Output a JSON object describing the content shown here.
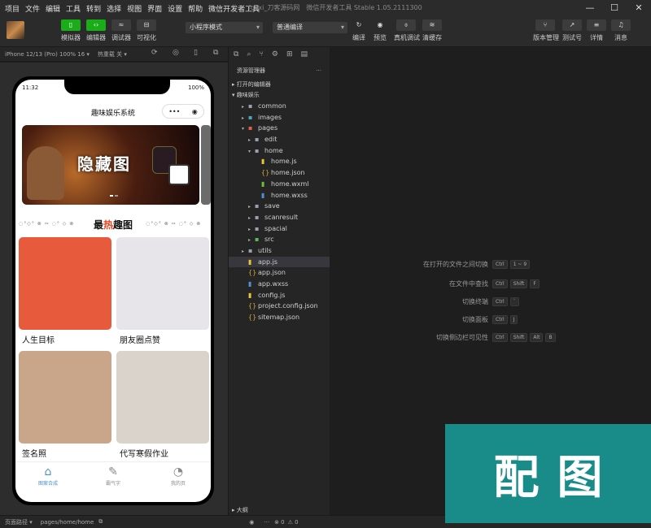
{
  "menubar": {
    "items": [
      "项目",
      "文件",
      "编辑",
      "工具",
      "转到",
      "选择",
      "视图",
      "界面",
      "设置",
      "帮助",
      "微信开发者工具"
    ],
    "window_title": "fooxi_刀客源码网　微信开发者工具 Stable 1.05.2111300",
    "controls": [
      "—",
      "☐",
      "✕"
    ]
  },
  "toolbar": {
    "simulator": "模拟器",
    "editor": "编辑器",
    "debugger": "调试器",
    "visual": "可视化",
    "mode_select": "小程序模式",
    "compile_select": "普通编译",
    "compile": "编译",
    "preview": "预览",
    "real_debug": "真机调试",
    "clear_cache": "清缓存",
    "version": "版本管理",
    "test": "测试号",
    "details": "详情",
    "messages": "消息"
  },
  "devbar": {
    "device": "iPhone 12/13 (Pro) 100% 16 ▾",
    "hot_reload": "热重载 关 ▾"
  },
  "phone": {
    "time": "11:32",
    "battery": "100%",
    "nav_title": "趣味娱乐系统",
    "capsule_menu": "•••",
    "capsule_close": "◉",
    "banner_text": "隐藏图",
    "section_title_a": "最",
    "section_title_hot": "热",
    "section_title_b": "趣图",
    "section_deco": "◌°◇° ⊗ ∾ ◌° ◇ ⊗",
    "cards": [
      {
        "label": "人生目标",
        "color": "#e85a3c"
      },
      {
        "label": "朋友圈点赞",
        "color": "#e7e4ea"
      },
      {
        "label": "签名照",
        "color": "#c9a58a"
      },
      {
        "label": "代写寒假作业",
        "color": "#d9d3cc"
      }
    ],
    "tabs": [
      {
        "label": "图案合成",
        "icon": "home-icon"
      },
      {
        "label": "霸气字",
        "icon": "pen-icon"
      },
      {
        "label": "我的页",
        "icon": "pie-icon"
      }
    ]
  },
  "bottombar": {
    "route_label": "页面路径 ▾",
    "route": "pages/home/home",
    "errors": "⊗ 0",
    "warnings": "⚠ 0"
  },
  "explorer": {
    "title": "资源管理器",
    "more": "···",
    "open_editors": "▸ 打开的编辑器",
    "project": "▾ 趣味娱乐",
    "tree": [
      {
        "label": "common",
        "type": "folder",
        "depth": 1,
        "open": false
      },
      {
        "label": "images",
        "type": "folder-img",
        "depth": 1,
        "open": false
      },
      {
        "label": "pages",
        "type": "folder-red",
        "depth": 1,
        "open": true
      },
      {
        "label": "edit",
        "type": "folder",
        "depth": 2,
        "open": false
      },
      {
        "label": "home",
        "type": "folder",
        "depth": 2,
        "open": true
      },
      {
        "label": "home.js",
        "type": "js",
        "depth": 3
      },
      {
        "label": "home.json",
        "type": "json",
        "depth": 3
      },
      {
        "label": "home.wxml",
        "type": "wxml",
        "depth": 3
      },
      {
        "label": "home.wxss",
        "type": "wxss",
        "depth": 3
      },
      {
        "label": "save",
        "type": "folder",
        "depth": 2,
        "open": false
      },
      {
        "label": "scanresult",
        "type": "folder",
        "depth": 2,
        "open": false
      },
      {
        "label": "spacial",
        "type": "folder",
        "depth": 2,
        "open": false
      },
      {
        "label": "src",
        "type": "folder-green",
        "depth": 2,
        "open": false
      },
      {
        "label": "utils",
        "type": "folder",
        "depth": 1,
        "open": false
      },
      {
        "label": "app.js",
        "type": "js",
        "depth": 1,
        "selected": true
      },
      {
        "label": "app.json",
        "type": "json",
        "depth": 1
      },
      {
        "label": "app.wxss",
        "type": "wxss",
        "depth": 1
      },
      {
        "label": "config.js",
        "type": "js",
        "depth": 1
      },
      {
        "label": "project.config.json",
        "type": "json",
        "depth": 1
      },
      {
        "label": "sitemap.json",
        "type": "json",
        "depth": 1
      }
    ],
    "outline": "▸ 大纲"
  },
  "editor": {
    "hints": [
      {
        "label": "在打开的文件之间切换",
        "keys": [
          "Ctrl",
          "1 ~ 9"
        ]
      },
      {
        "label": "在文件中查找",
        "keys": [
          "Ctrl",
          "Shift",
          "F"
        ]
      },
      {
        "label": "切换终端",
        "keys": [
          "Ctrl",
          "`"
        ]
      },
      {
        "label": "切换面板",
        "keys": [
          "Ctrl",
          "J"
        ]
      },
      {
        "label": "切换侧边栏可见性",
        "keys": [
          "Ctrl",
          "Shift",
          "Alt",
          "B"
        ]
      }
    ]
  },
  "watermark": {
    "text": "配图"
  }
}
